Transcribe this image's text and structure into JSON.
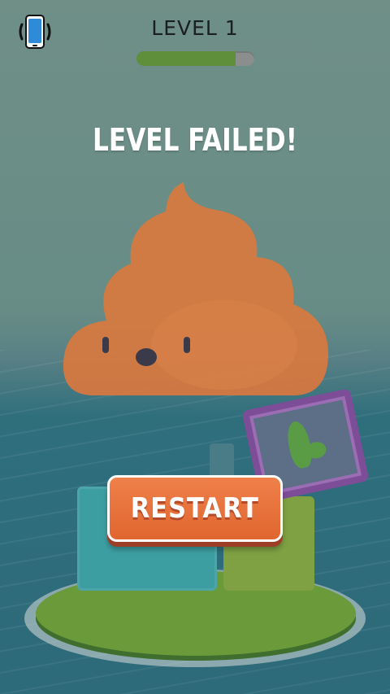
{
  "hud": {
    "level_label": "LEVEL 1",
    "progress_fraction": 0.84,
    "vibration_icon": "phone-vibrate-icon"
  },
  "result": {
    "title": "LEVEL FAILED!",
    "mascot_icon": "poop-mascot-icon"
  },
  "actions": {
    "restart_label": "RESTART"
  },
  "colors": {
    "accent_orange": "#e96f3a",
    "progress_green": "#5f8f3b",
    "crate_purple": "#7e4d98"
  }
}
